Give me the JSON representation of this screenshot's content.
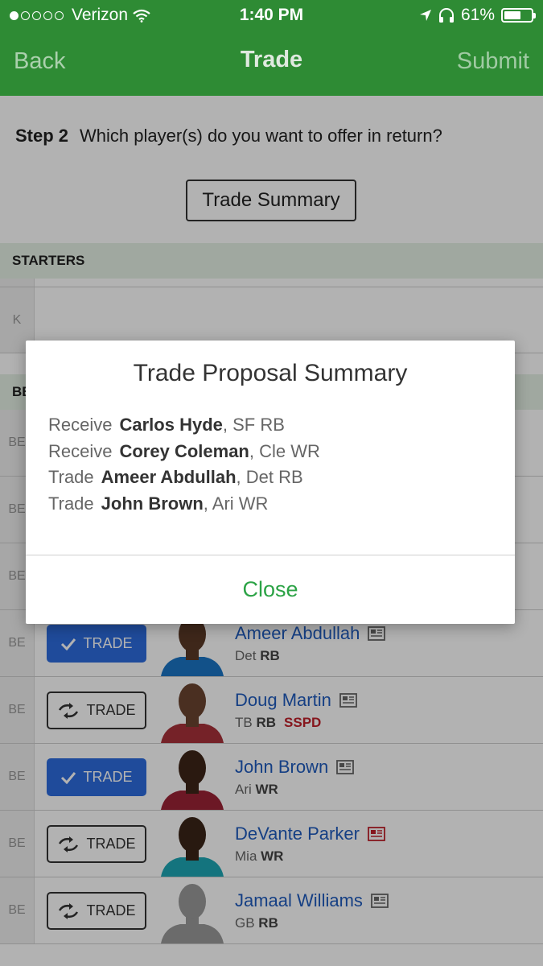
{
  "status": {
    "carrier": "Verizon",
    "time": "1:40 PM",
    "battery": "61%",
    "battery_level": 0.61
  },
  "nav": {
    "back": "Back",
    "title": "Trade",
    "submit": "Submit"
  },
  "step": {
    "label": "Step 2",
    "text": "Which player(s) do you want to offer in return?"
  },
  "summary_button": "Trade Summary",
  "sections": {
    "starters": "STARTERS",
    "bench_partial": "BE"
  },
  "k_slot": "K",
  "bench_slot": "BE",
  "trade_label": "TRADE",
  "players": [
    {
      "name": "Ameer Abdullah",
      "team": "Det",
      "pos": "RB",
      "status": "",
      "selected": true,
      "news_alert": false,
      "jersey": "#1b74c4",
      "skin": "#5a3826"
    },
    {
      "name": "Doug Martin",
      "team": "TB",
      "pos": "RB",
      "status": "SSPD",
      "selected": false,
      "news_alert": false,
      "jersey": "#a8323a",
      "skin": "#6b4430"
    },
    {
      "name": "John Brown",
      "team": "Ari",
      "pos": "WR",
      "status": "",
      "selected": true,
      "news_alert": false,
      "jersey": "#9b2335",
      "skin": "#3d2518"
    },
    {
      "name": "DeVante Parker",
      "team": "Mia",
      "pos": "WR",
      "status": "",
      "selected": false,
      "news_alert": true,
      "jersey": "#1ea7b5",
      "skin": "#3a2418"
    },
    {
      "name": "Jamaal Williams",
      "team": "GB",
      "pos": "RB",
      "status": "",
      "selected": false,
      "news_alert": false,
      "jersey": "#9a9a9a",
      "skin": "#9a9a9a"
    }
  ],
  "modal": {
    "title": "Trade Proposal Summary",
    "lines": [
      {
        "verb": "Receive",
        "player": "Carlos Hyde",
        "detail": ", SF RB"
      },
      {
        "verb": "Receive",
        "player": "Corey Coleman",
        "detail": ", Cle WR"
      },
      {
        "verb": "Trade",
        "player": "Ameer Abdullah",
        "detail": ", Det RB"
      },
      {
        "verb": "Trade",
        "player": "John Brown",
        "detail": ", Ari WR"
      }
    ],
    "close": "Close"
  },
  "colors": {
    "header_green": "#2e8b34",
    "accent_blue": "#2d6cdf",
    "close_green": "#2ca346",
    "suspended_red": "#c0202a"
  }
}
